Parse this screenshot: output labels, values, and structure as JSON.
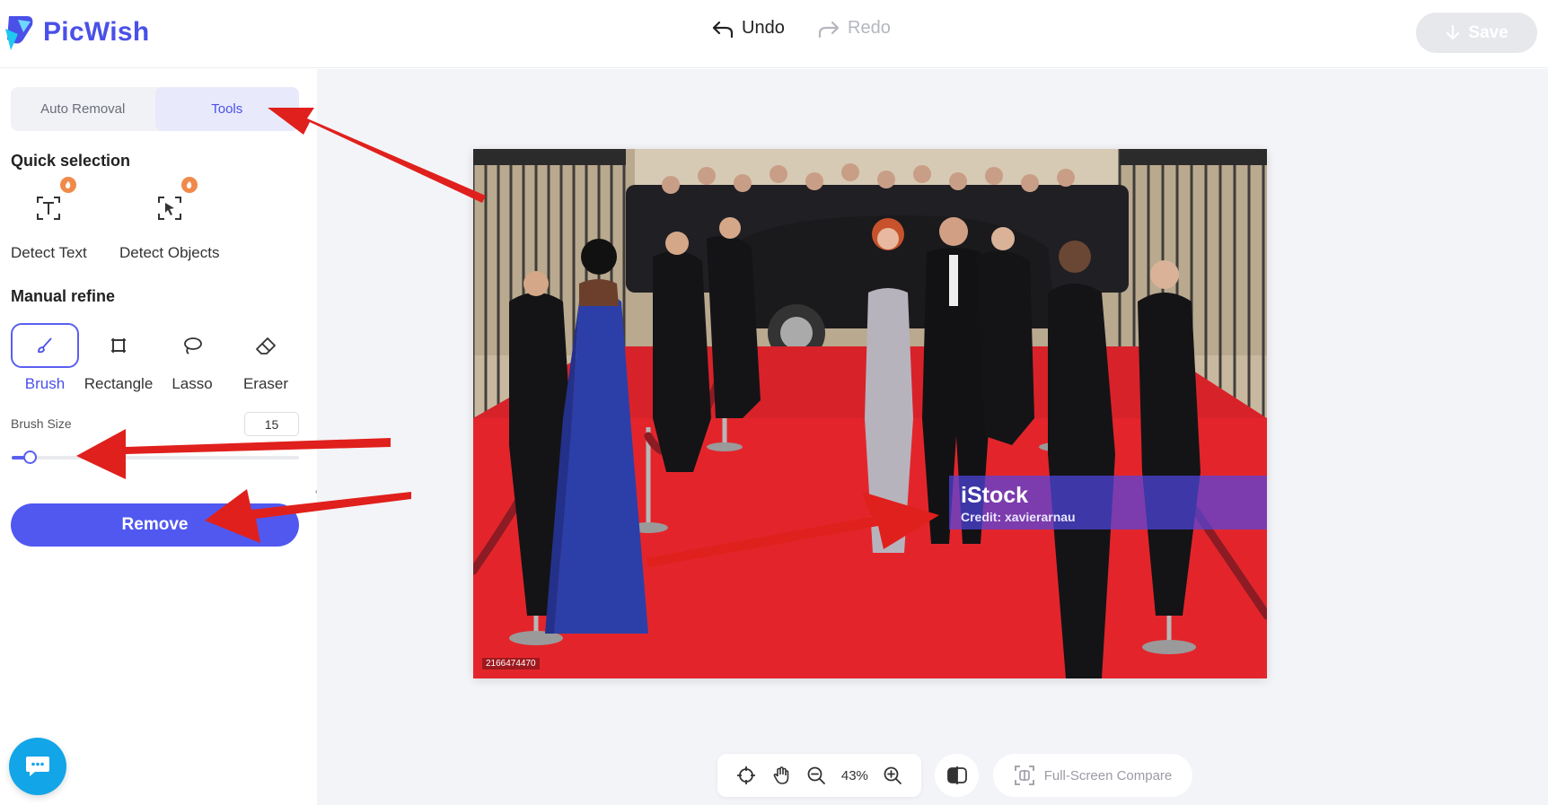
{
  "app": {
    "name": "PicWish"
  },
  "header": {
    "undo_label": "Undo",
    "redo_label": "Redo",
    "save_label": "Save"
  },
  "sidebar": {
    "tabs": [
      {
        "label": "Auto Removal",
        "active": false
      },
      {
        "label": "Tools",
        "active": true
      }
    ],
    "quick_selection": {
      "title": "Quick selection",
      "tools": [
        {
          "label": "Detect Text",
          "icon": "detect-text-icon",
          "badge": "hot-icon"
        },
        {
          "label": "Detect Objects",
          "icon": "detect-objects-icon",
          "badge": "hot-icon"
        }
      ]
    },
    "manual_refine": {
      "title": "Manual refine",
      "tools": [
        {
          "label": "Brush",
          "icon": "brush-icon",
          "active": true
        },
        {
          "label": "Rectangle",
          "icon": "rectangle-icon",
          "active": false
        },
        {
          "label": "Lasso",
          "icon": "lasso-icon",
          "active": false
        },
        {
          "label": "Eraser",
          "icon": "eraser-icon",
          "active": false
        }
      ]
    },
    "brush_size": {
      "label": "Brush Size",
      "value": "15",
      "slider_fraction": 0.05
    },
    "remove_label": "Remove"
  },
  "canvas": {
    "watermark_title": "iStock",
    "watermark_credit": "Credit: xavierarnau",
    "photo_id": "2166474470"
  },
  "bottom_toolbar": {
    "zoom": "43%",
    "fullscreen_compare_label": "Full-Screen Compare"
  },
  "colors": {
    "accent": "#4a50e8",
    "remove_button": "#5158f0",
    "chat_button": "#12a5e8",
    "annotation_arrow": "#e0201c",
    "watermark_overlay": "#5046e6"
  }
}
